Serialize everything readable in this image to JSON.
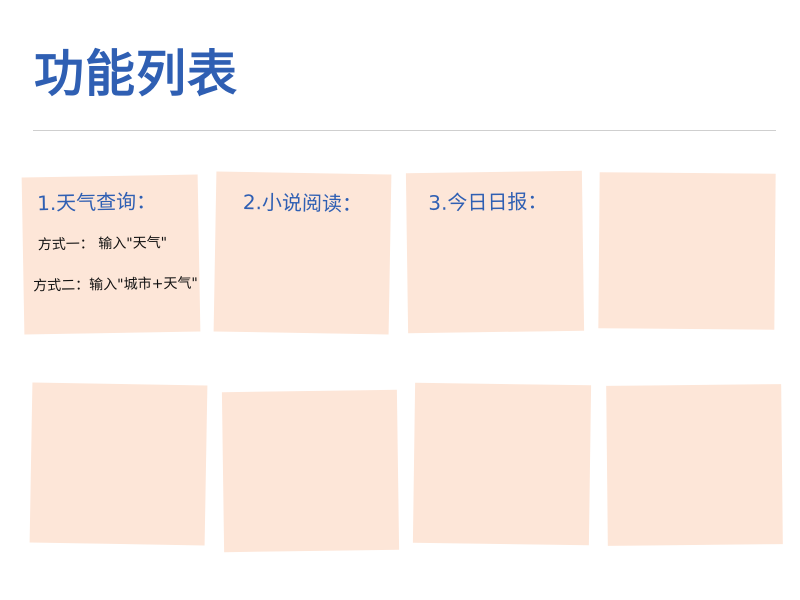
{
  "page": {
    "title": "功能列表"
  },
  "cards": [
    {
      "title": "1.天气查询：",
      "lines": [
        "方式一：  输入\"天气\"",
        "方式二：输入\"城市+天气\""
      ]
    },
    {
      "title": "2.小说阅读："
    },
    {
      "title": "3.今日日报："
    },
    {
      "title": ""
    },
    {
      "title": ""
    },
    {
      "title": ""
    },
    {
      "title": ""
    },
    {
      "title": ""
    }
  ],
  "colors": {
    "title": "#2f5fb3",
    "card_background": "#fde6d8",
    "divider": "#cfcfcf"
  }
}
